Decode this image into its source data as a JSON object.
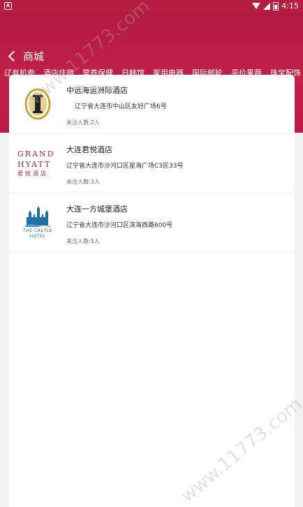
{
  "status_bar": {
    "time": "4:15",
    "left_icon": "A"
  },
  "header": {
    "title": "商城"
  },
  "tabs": [
    {
      "label": "辽有机参"
    },
    {
      "label": "酒店住宿"
    },
    {
      "label": "营养保健"
    },
    {
      "label": "日韩馆"
    },
    {
      "label": "家用电器"
    },
    {
      "label": "国际邮轮"
    },
    {
      "label": "平价果蔬"
    },
    {
      "label": "珠宝配饰"
    }
  ],
  "active_tab_index": 1,
  "hotels": [
    {
      "name": "中远海运洲际酒店",
      "address": "辽宁省大连市中山区友好广场6号",
      "followers": "关注人数:2人",
      "logo_icon": "intercontinental-logo"
    },
    {
      "name": "大连君悦酒店",
      "address": "辽宁省大连市沙河口区星海广场C3区33号",
      "followers": "关注人数:3人",
      "logo_icon": "grand-hyatt-logo",
      "logo_text": [
        "GRAND",
        "HYATT",
        "君悦酒店"
      ]
    },
    {
      "name": "大连一方城堡酒店",
      "address": "辽宁省大连市沙河口区滨海西路600号",
      "followers": "关注人数:5人",
      "logo_icon": "castle-hotel-logo",
      "logo_text": [
        "THE CASTLE",
        "HOTEL"
      ]
    }
  ],
  "watermark": "www.11773.com",
  "colors": {
    "brand": "#b51d41",
    "hyatt_red": "#b42338",
    "castle_blue": "#1f6ea6",
    "gold": "#c9a33a"
  }
}
